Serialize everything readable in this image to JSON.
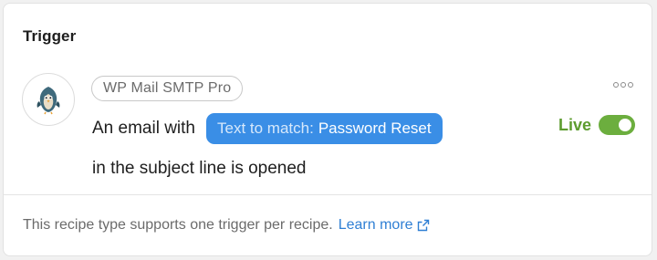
{
  "section": {
    "title": "Trigger"
  },
  "trigger": {
    "integration": "WP Mail SMTP Pro",
    "integration_icon": "bird-logo-icon",
    "sentence_start": "An email with",
    "token_label": "Text to match:",
    "token_value": "Password Reset",
    "sentence_end": "in the subject line is opened",
    "status_label": "Live",
    "toggle_on": true
  },
  "footer": {
    "note": "This recipe type supports one trigger per recipe.",
    "link_label": "Learn more",
    "link_icon": "external-link-icon"
  },
  "colors": {
    "token_bg": "#3a8ee6",
    "live_green": "#5d9c2f",
    "toggle_green": "#6cae3e",
    "link_blue": "#2f7fd4"
  }
}
